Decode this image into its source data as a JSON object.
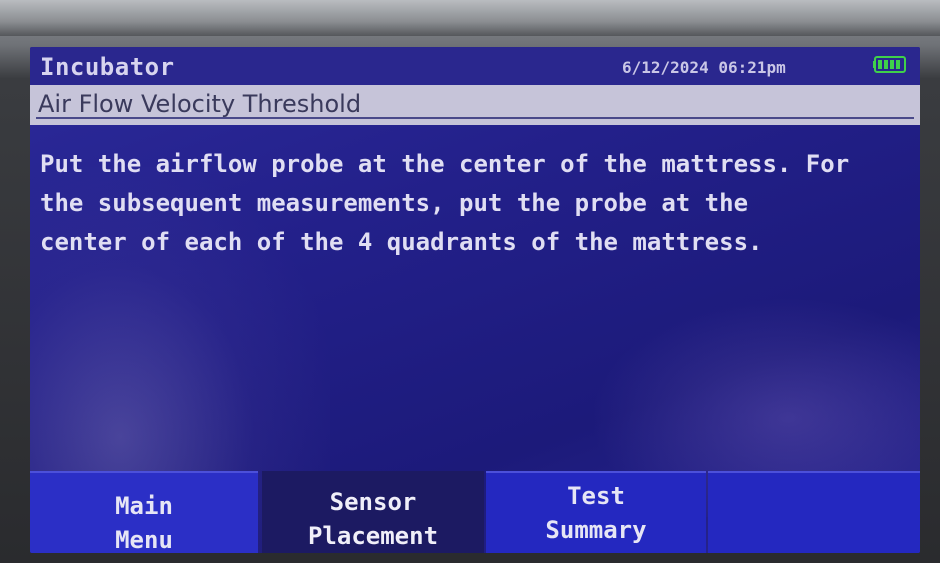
{
  "header": {
    "title": "Incubator",
    "datetime": "6/12/2024 06:21pm",
    "battery_icon": "battery-full-icon"
  },
  "screen": {
    "subtitle": "Air Flow Velocity Threshold",
    "instruction": "Put the airflow probe at the center of the mattress. For\nthe subsequent measurements, put the probe at the\ncenter of each of the 4 quadrants of the mattress."
  },
  "softkeys": [
    {
      "line1": "Main",
      "line2": "Menu"
    },
    {
      "line1": "Sensor",
      "line2": "Placement"
    },
    {
      "line1": "Test",
      "line2": "Summary"
    },
    {
      "line1": "",
      "line2": ""
    }
  ],
  "colors": {
    "screen_bg": "#23208a",
    "softkey_bg": "#2b2fc6",
    "subtitle_bg": "#c6c4d9",
    "battery": "#3fd24a"
  }
}
